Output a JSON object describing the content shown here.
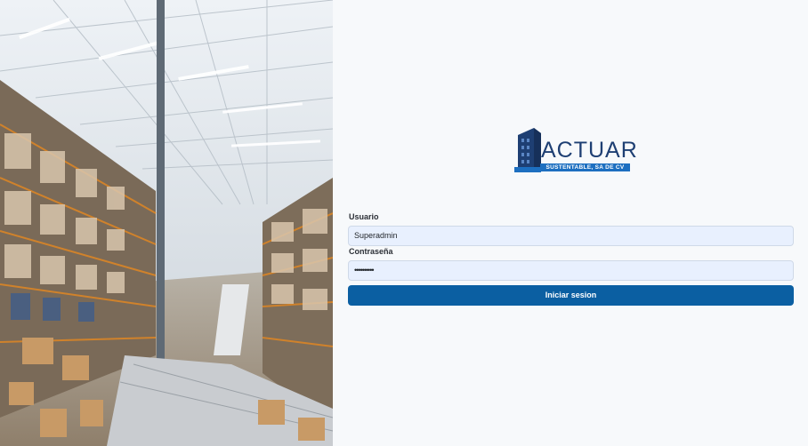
{
  "hero": {
    "image": "warehouse-photo"
  },
  "logo": {
    "name": "ACTUAR",
    "tagline": "SUSTENTABLE, SA DE CV"
  },
  "login": {
    "user_label": "Usuario",
    "user_value": "Superadmin",
    "password_label": "Contraseña",
    "password_value": "••••••••••",
    "submit_label": "Iniciar sesion"
  },
  "colors": {
    "primary_button": "#0b5fa2",
    "input_background": "#e8f0fe",
    "logo_blue": "#1e3f73",
    "logo_strip": "#1d6fc0"
  }
}
